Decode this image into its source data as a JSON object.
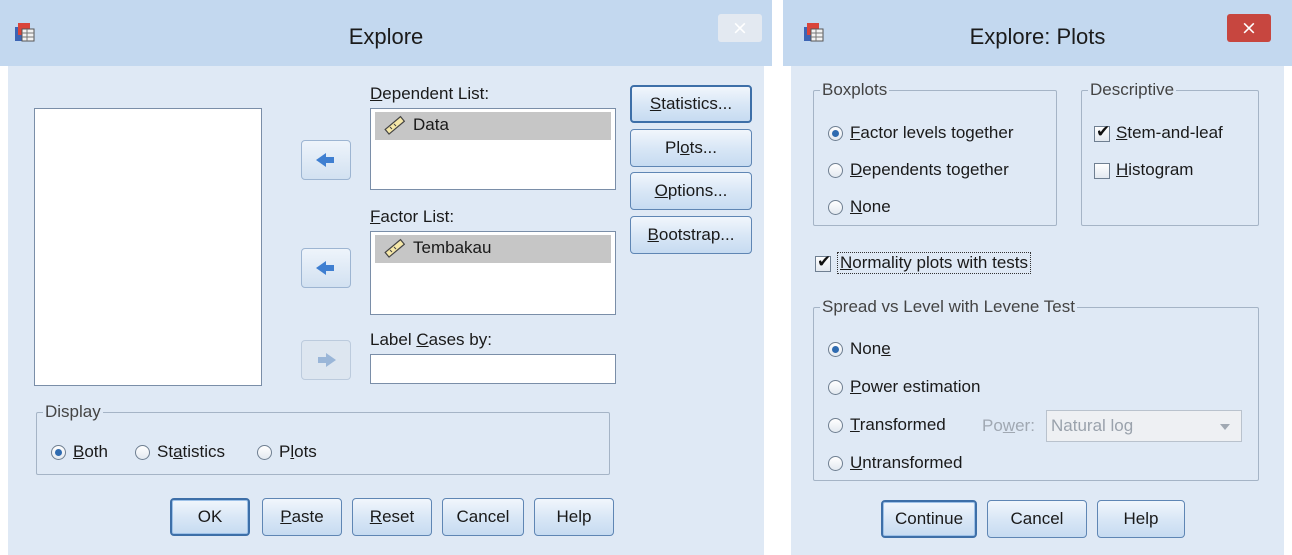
{
  "explore": {
    "title": "Explore",
    "close_label": "×",
    "dependent_list": {
      "label": "Dependent List:",
      "items": [
        "Data"
      ]
    },
    "factor_list": {
      "label": "Factor List:",
      "items": [
        "Tembakau"
      ]
    },
    "label_cases": {
      "label": "Label Cases by:",
      "value": ""
    },
    "side_buttons": [
      "Statistics...",
      "Plots...",
      "Options...",
      "Bootstrap..."
    ],
    "display": {
      "legend": "Display",
      "options": [
        "Both",
        "Statistics",
        "Plots"
      ],
      "selected": "Both"
    },
    "buttons": [
      "OK",
      "Paste",
      "Reset",
      "Cancel",
      "Help"
    ]
  },
  "plots": {
    "title": "Explore: Plots",
    "close_label": "×",
    "boxplots": {
      "legend": "Boxplots",
      "options": [
        "Factor levels together",
        "Dependents together",
        "None"
      ],
      "selected": "Factor levels together"
    },
    "descriptive": {
      "legend": "Descriptive",
      "options": [
        {
          "label": "Stem-and-leaf",
          "checked": true
        },
        {
          "label": "Histogram",
          "checked": false
        }
      ]
    },
    "normality": {
      "label": "Normality plots with tests",
      "checked": true
    },
    "spread": {
      "legend": "Spread vs Level with Levene Test",
      "options": [
        "None",
        "Power estimation",
        "Transformed",
        "Untransformed"
      ],
      "selected": "None",
      "power_label": "Power:",
      "power_value": "Natural log"
    },
    "buttons": [
      "Continue",
      "Cancel",
      "Help"
    ]
  },
  "colors": {
    "titlebar": "#c3d8ef",
    "client": "#dfe9f5",
    "close_red": "#c7463f",
    "accent": "#2f6bb0"
  }
}
